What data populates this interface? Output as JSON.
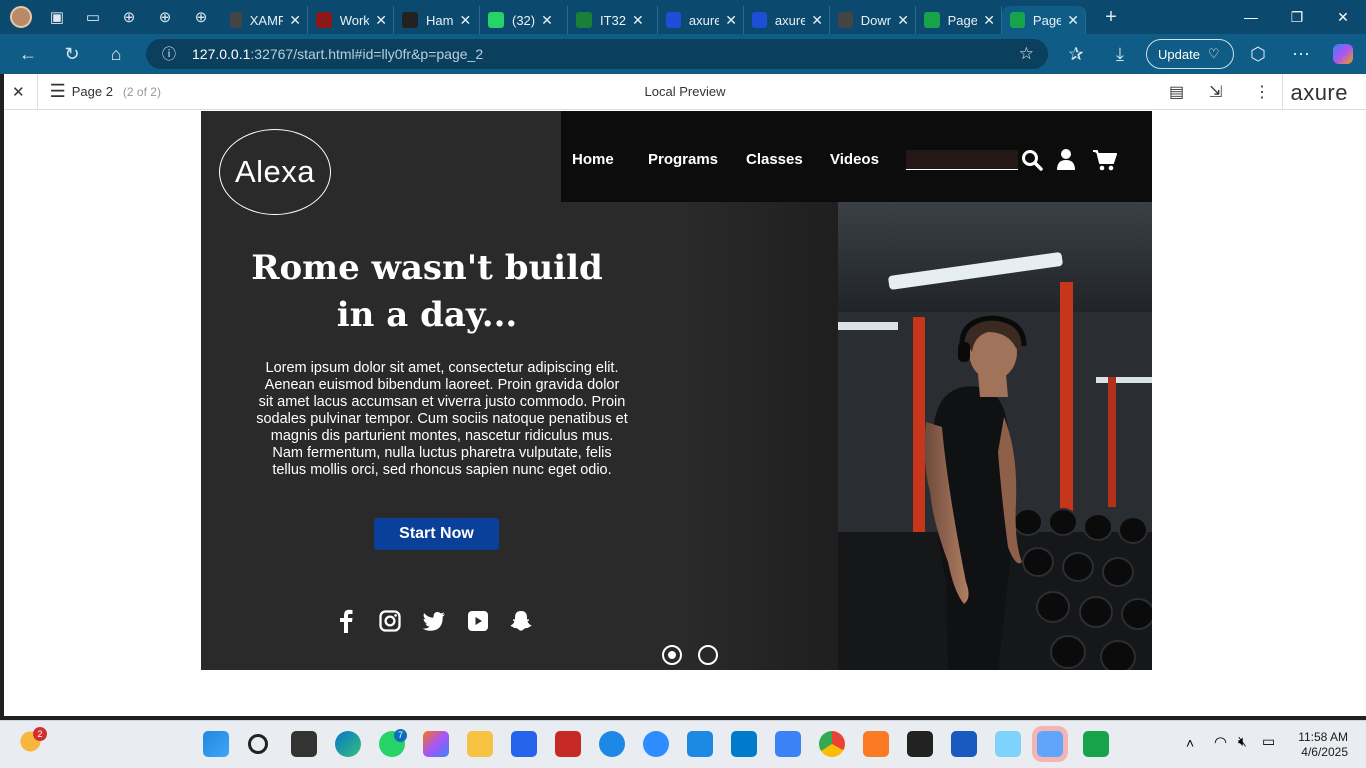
{
  "browser": {
    "tabs": [
      {
        "title": "XAMPP",
        "icon": "xampp-icon",
        "color": "#444444"
      },
      {
        "title": "Work",
        "icon": "pdf-icon",
        "color": "#8a1a1a"
      },
      {
        "title": "Ham",
        "icon": "github-icon",
        "color": "#222222"
      },
      {
        "title": "(32)",
        "icon": "whatsapp-icon",
        "color": "#25d366"
      },
      {
        "title": "IT32",
        "icon": "sheets-icon",
        "color": "#188038"
      },
      {
        "title": "axure",
        "icon": "search-icon",
        "color": "#1d4ed8"
      },
      {
        "title": "axure",
        "icon": "search-icon",
        "color": "#1d4ed8"
      },
      {
        "title": "Down",
        "icon": "x-icon",
        "color": "#444444"
      },
      {
        "title": "Page",
        "icon": "axure-play-icon",
        "color": "#16a34a"
      },
      {
        "title": "Page",
        "icon": "axure-play-icon",
        "color": "#16a34a"
      }
    ],
    "address": {
      "host": "127.0.0.1",
      "path": ":32767/start.html#id=lly0fr&p=page_2"
    },
    "update_label": "Update"
  },
  "axure": {
    "page_label": "Page 2",
    "page_count": "(2 of 2)",
    "title": "Local Preview",
    "brand": "axure"
  },
  "site": {
    "logo": "Alexa",
    "nav": [
      "Home",
      "Programs",
      "Classes",
      "Videos"
    ],
    "headline": "Rome wasn't build in a day...",
    "body": "Lorem ipsum dolor sit amet, consectetur adipiscing elit. Aenean euismod bibendum laoreet. Proin gravida dolor sit amet lacus accumsan et viverra justo commodo. Proin sodales pulvinar tempor. Cum sociis natoque penatibus et magnis dis parturient montes, nascetur ridiculus mus. Nam fermentum, nulla luctus pharetra vulputate, felis tellus mollis orci, sed rhoncus sapien nunc eget odio.",
    "cta": "Start Now",
    "social_icons": [
      "facebook-icon",
      "instagram-icon",
      "twitter-icon",
      "youtube-icon",
      "snapchat-icon"
    ],
    "slides_total": 2,
    "slide_active": 1
  },
  "taskbar": {
    "badge_weather": "2",
    "badge_whatsapp": "7",
    "time": "11:58 AM",
    "date": "4/6/2025"
  }
}
